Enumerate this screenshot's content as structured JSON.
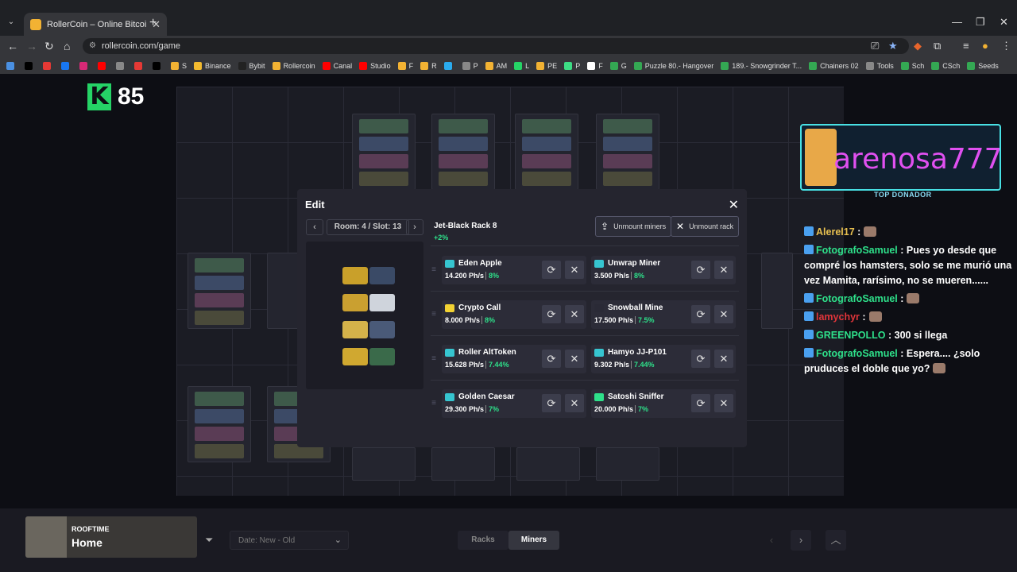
{
  "browser": {
    "tab_title": "RollerCoin – Online Bitcoin Mi",
    "url": "rollercoin.com/game",
    "bookmarks": [
      {
        "label": "",
        "color": "#4a90e2"
      },
      {
        "label": "",
        "color": "#000000"
      },
      {
        "label": "",
        "color": "#e53935"
      },
      {
        "label": "",
        "color": "#1877f2"
      },
      {
        "label": "",
        "color": "#d62976"
      },
      {
        "label": "",
        "color": "#ff0000"
      },
      {
        "label": "",
        "color": "#888888"
      },
      {
        "label": "",
        "color": "#e53935"
      },
      {
        "label": "",
        "color": "#000000"
      },
      {
        "label": "S",
        "color": "#f2b233"
      },
      {
        "label": "Binance",
        "color": "#f3ba2f"
      },
      {
        "label": "Bybit",
        "color": "#222222"
      },
      {
        "label": "Rollercoin",
        "color": "#f2b233"
      },
      {
        "label": "Canal",
        "color": "#ff0000"
      },
      {
        "label": "Studio",
        "color": "#ff0000"
      },
      {
        "label": "F",
        "color": "#f2b233"
      },
      {
        "label": "R",
        "color": "#f2b233"
      },
      {
        "label": "",
        "color": "#2aabee"
      },
      {
        "label": "P",
        "color": "#888888"
      },
      {
        "label": "AM",
        "color": "#f2b233"
      },
      {
        "label": "L",
        "color": "#25d366"
      },
      {
        "label": "PE",
        "color": "#f2b233"
      },
      {
        "label": "P",
        "color": "#3ddc84"
      },
      {
        "label": "F",
        "color": "#ffffff"
      },
      {
        "label": "G",
        "color": "#34a853"
      },
      {
        "label": "Puzzle 80.- Hangover",
        "color": "#34a853"
      },
      {
        "label": "189.- Snowgrinder T...",
        "color": "#34a853"
      },
      {
        "label": "Chainers 02",
        "color": "#34a853"
      },
      {
        "label": "Tools",
        "color": "#888888"
      },
      {
        "label": "Sch",
        "color": "#34a853"
      },
      {
        "label": "CSch",
        "color": "#34a853"
      },
      {
        "label": "Seeds",
        "color": "#34a853"
      }
    ]
  },
  "logo": {
    "letter": "K",
    "number": "85"
  },
  "donor": {
    "name": "arenosa777",
    "label": "TOP DONADOR"
  },
  "chat": [
    {
      "user": "Alerel17",
      "text": " :",
      "cls": "u0",
      "emote": true
    },
    {
      "user": "FotografoSamuel",
      "text": " : Pues yo desde que compré los hamsters, solo se me murió una vez Mamita, rarísimo, no se mueren......",
      "cls": "u",
      "emote": false
    },
    {
      "user": "FotografoSamuel",
      "text": " :",
      "cls": "u",
      "emote": true
    },
    {
      "user": "lamychyr",
      "text": " :",
      "cls": "u2",
      "emote": true
    },
    {
      "user": "GREENPOLLO",
      "text": " : 300 si llega",
      "cls": "u3",
      "emote": false
    },
    {
      "user": "FotografoSamuel",
      "text": " : Espera.... ¿solo pruduces el doble que yo?",
      "cls": "u",
      "emote": true
    }
  ],
  "modal": {
    "title": "Edit",
    "room_slot": "Room: 4 / Slot: 13",
    "rack_name": "Jet-Black Rack 8",
    "rack_bonus": "+2%",
    "unmount_miners": "Unmount miners",
    "unmount_rack": "Unmount rack",
    "miners": [
      {
        "name": "Eden Apple",
        "power": "14.200 Ph/s",
        "bonus": "8%",
        "tier_color": "#36c5d0"
      },
      {
        "name": "Unwrap Miner",
        "power": "3.500 Ph/s",
        "bonus": "8%",
        "tier_color": "#36c5d0"
      },
      {
        "name": "Crypto Call",
        "power": "8.000 Ph/s",
        "bonus": "8%",
        "tier_color": "#f2d233"
      },
      {
        "name": "Snowball Mine",
        "power": "17.500 Ph/s",
        "bonus": "7.5%",
        "tier_color": "#2a2a36"
      },
      {
        "name": "Roller AltToken",
        "power": "15.628 Ph/s",
        "bonus": "7.44%",
        "tier_color": "#36c5d0"
      },
      {
        "name": "Hamyo JJ-P101",
        "power": "9.302 Ph/s",
        "bonus": "7.44%",
        "tier_color": "#36c5d0"
      },
      {
        "name": "Golden Caesar",
        "power": "29.300 Ph/s",
        "bonus": "7%",
        "tier_color": "#36c5d0"
      },
      {
        "name": "Satoshi Sniffer",
        "power": "20.000 Ph/s",
        "bonus": "7%",
        "tier_color": "#2ee08a"
      }
    ]
  },
  "bottom": {
    "room_label": "ROOFTIME",
    "room_name": "Home",
    "date_filter": "Date: New - Old",
    "tab_racks": "Racks",
    "tab_miners": "Miners"
  }
}
